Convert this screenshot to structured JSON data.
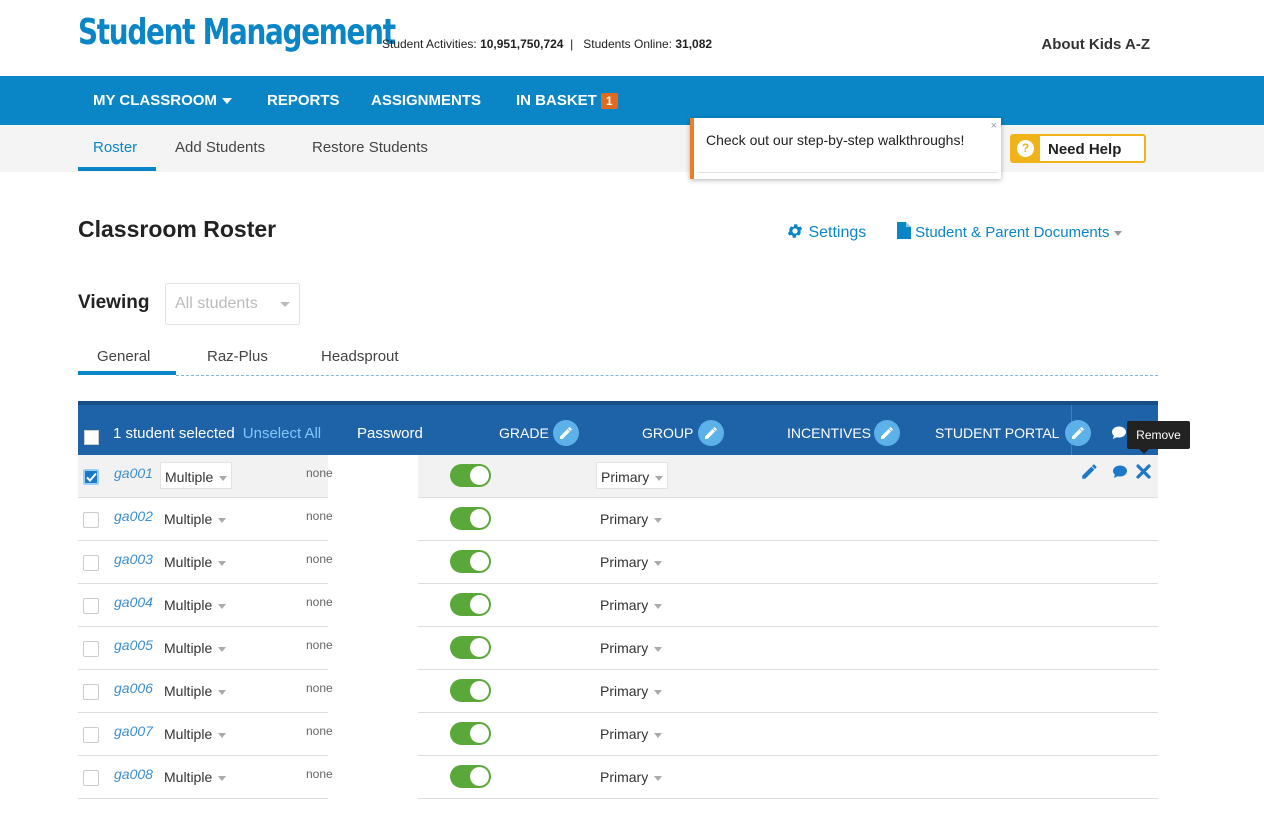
{
  "header": {
    "logo": "Student Management",
    "activities_label": "Student Activities:",
    "activities_value": "10,951,750,724",
    "online_label": "Students Online:",
    "online_value": "31,082",
    "about": "About Kids A-Z"
  },
  "nav": {
    "items": [
      "MY CLASSROOM",
      "REPORTS",
      "ASSIGNMENTS",
      "IN BASKET"
    ],
    "basket_count": "1"
  },
  "subnav": {
    "tabs": [
      "Roster",
      "Add Students",
      "Restore Students"
    ]
  },
  "popup": {
    "text": "Check out our step-by-step walkthroughs!",
    "close": "×"
  },
  "help": {
    "icon": "?",
    "label": "Need Help"
  },
  "page": {
    "title": "Classroom Roster",
    "settings": "Settings",
    "documents": "Student & Parent Documents",
    "viewing_label": "Viewing",
    "viewing_value": "All students"
  },
  "tabs": [
    "General",
    "Raz-Plus",
    "Headsprout"
  ],
  "table": {
    "selected_text": "1 student selected",
    "unselect": "Unselect All",
    "columns": {
      "password": "Password",
      "grade": "GRADE",
      "group": "GROUP",
      "incentives": "INCENTIVES",
      "portal": "STUDENT PORTAL"
    },
    "tooltip": "Remove",
    "rows": [
      {
        "name": "ga001",
        "grade": "Multiple",
        "group": "none",
        "portal": "Primary"
      },
      {
        "name": "ga002",
        "grade": "Multiple",
        "group": "none",
        "portal": "Primary"
      },
      {
        "name": "ga003",
        "grade": "Multiple",
        "group": "none",
        "portal": "Primary"
      },
      {
        "name": "ga004",
        "grade": "Multiple",
        "group": "none",
        "portal": "Primary"
      },
      {
        "name": "ga005",
        "grade": "Multiple",
        "group": "none",
        "portal": "Primary"
      },
      {
        "name": "ga006",
        "grade": "Multiple",
        "group": "none",
        "portal": "Primary"
      },
      {
        "name": "ga007",
        "grade": "Multiple",
        "group": "none",
        "portal": "Primary"
      },
      {
        "name": "ga008",
        "grade": "Multiple",
        "group": "none",
        "portal": "Primary"
      }
    ]
  }
}
